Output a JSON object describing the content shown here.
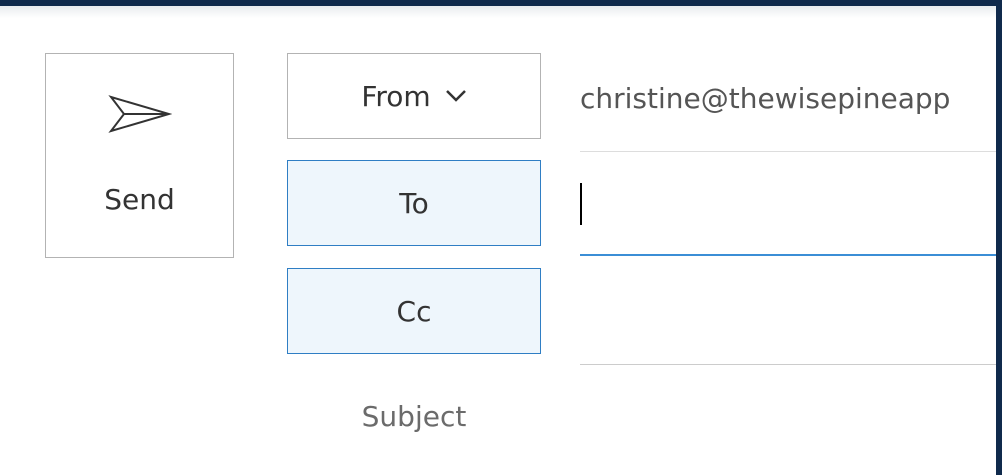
{
  "compose": {
    "send_label": "Send",
    "from_label": "From",
    "from_value": "christine@thewisepineapp",
    "to_label": "To",
    "to_value": "",
    "cc_label": "Cc",
    "cc_value": "",
    "subject_label": "Subject"
  },
  "icons": {
    "send": "send-icon",
    "from_dropdown": "chevron-down-icon"
  },
  "colors": {
    "header_bar": "#102a4c",
    "field_button_active_bg": "#eef6fc",
    "field_button_active_border": "#2f7ec4",
    "focus_underline": "#3b8ed6"
  }
}
